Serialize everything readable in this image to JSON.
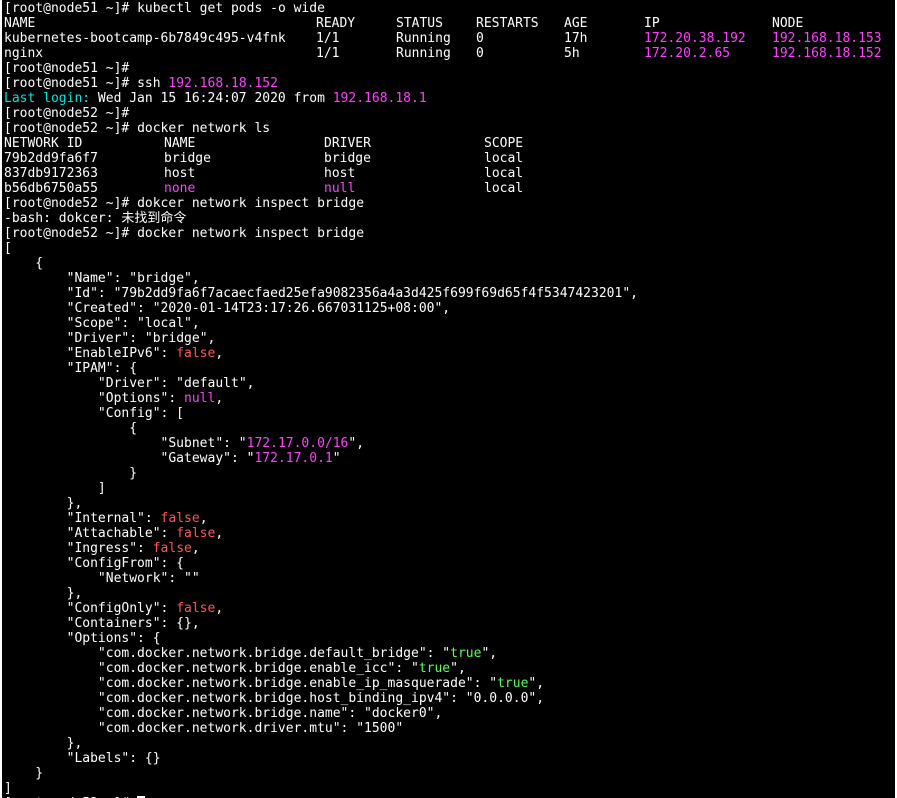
{
  "terminal": {
    "prompt51": "[root@node51 ~]#",
    "prompt52": "[root@node52 ~]#",
    "cmd_kubectl": "kubectl get pods -o wide",
    "pods_headers": [
      "NAME",
      "READY",
      "STATUS",
      "RESTARTS",
      "AGE",
      "IP",
      "NODE"
    ],
    "pods": [
      {
        "name": "kubernetes-bootcamp-6b7849c495-v4fnk",
        "ready": "1/1",
        "status": "Running",
        "restarts": "0",
        "age": "17h",
        "ip": "172.20.38.192",
        "node": "192.168.18.153"
      },
      {
        "name": "nginx",
        "ready": "1/1",
        "status": "Running",
        "restarts": "0",
        "age": "5h",
        "ip": "172.20.2.65",
        "node": "192.168.18.152"
      }
    ],
    "cmd_ssh": "ssh",
    "ssh_host": "192.168.18.152",
    "last_login_label": "Last login:",
    "last_login_date": "Wed Jan 15 16:24:07 2020 from",
    "last_login_host": "192.168.18.1",
    "cmd_network_ls": "docker network ls",
    "net_headers": [
      "NETWORK ID",
      "NAME",
      "DRIVER",
      "SCOPE"
    ],
    "networks": [
      {
        "id": "79b2dd9fa6f7",
        "name": "bridge",
        "driver": "bridge",
        "scope": "local"
      },
      {
        "id": "837db9172363",
        "name": "host",
        "driver": "host",
        "scope": "local"
      },
      {
        "id": "b56db6750a55",
        "name": "none",
        "driver": "null",
        "scope": "local"
      }
    ],
    "cmd_typo": "dokcer network inspect bridge",
    "typo_error": "-bash: dokcer: 未找到命令",
    "cmd_inspect": "docker network inspect bridge",
    "json": {
      "name": "bridge",
      "id": "79b2dd9fa6f7acaecfaed25efa9082356a4a3d425f699f69d65f4f5347423201",
      "created": "2020-01-14T23:17:26.667031125+08:00",
      "scope": "local",
      "driver": "bridge",
      "enable_ipv6": "false",
      "ipam_driver": "default",
      "ipam_options": "null",
      "subnet": "172.17.0.0/16",
      "gateway": "172.17.0.1",
      "internal": "false",
      "attachable": "false",
      "ingress": "false",
      "network": "",
      "config_only": "false",
      "opt_default_bridge_value": "true",
      "opt_enable_icc_value": "true",
      "opt_enable_ip_masquerade_value": "true",
      "opt_host_binding_ipv4_value": "0.0.0.0",
      "opt_bridge_name_value": "docker0",
      "opt_driver_mtu_value": "1500"
    }
  }
}
